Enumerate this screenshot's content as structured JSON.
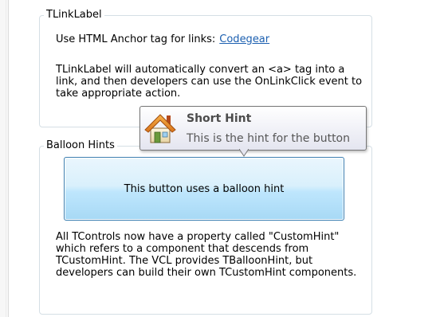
{
  "linklabel_group": {
    "title": "TLinkLabel",
    "anchor_text": "Use HTML Anchor tag for links:",
    "link_text": "Codegear",
    "description": "TLinkLabel will automatically convert an <a> tag into a link, and then developers can use the OnLinkClick event to take appropriate action."
  },
  "balloon_group": {
    "title": "Balloon Hints",
    "button_label": "This button uses a balloon hint",
    "description": "All TControls now have a property called \"CustomHint\" which refers to a component that descends  from TCustomHint. The VCL provides TBalloonHint, but developers can build their own TCustomHint components."
  },
  "hint": {
    "title": "Short Hint",
    "text": "This is the hint for the button",
    "icon": "house-icon"
  },
  "colors": {
    "link": "#1b5fb0",
    "group_border": "#d5dfe5",
    "button_border": "#3c7fb1",
    "button_fill": "#bee6fd"
  }
}
